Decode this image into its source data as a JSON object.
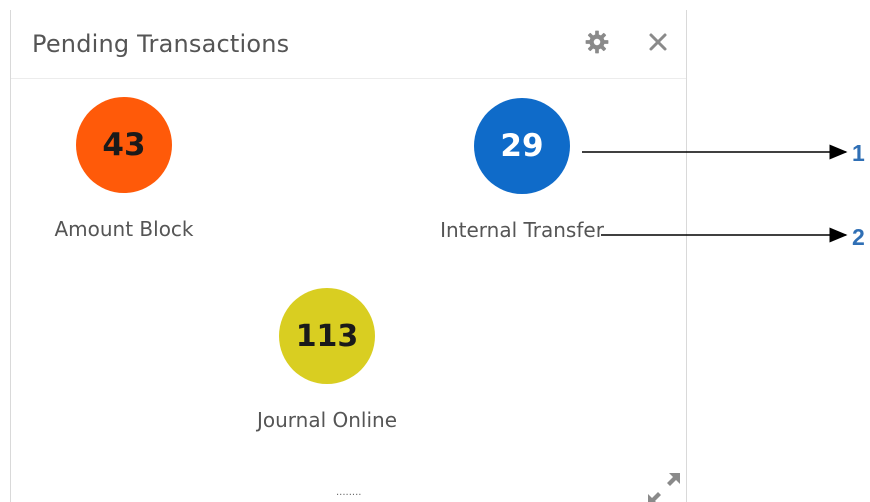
{
  "widget": {
    "title": "Pending Transactions",
    "icons": {
      "settings": "gear-icon",
      "close": "close-icon",
      "expand": "expand-icon"
    },
    "grip": "........"
  },
  "tiles": [
    {
      "count": "43",
      "label": "Amount Block",
      "color": "#ff5a09"
    },
    {
      "count": "29",
      "label": "Internal Transfer",
      "color": "#0f6bc9"
    },
    {
      "count": "113",
      "label": "Journal Online",
      "color": "#d9ce21"
    }
  ],
  "callouts": [
    "1",
    "2"
  ]
}
